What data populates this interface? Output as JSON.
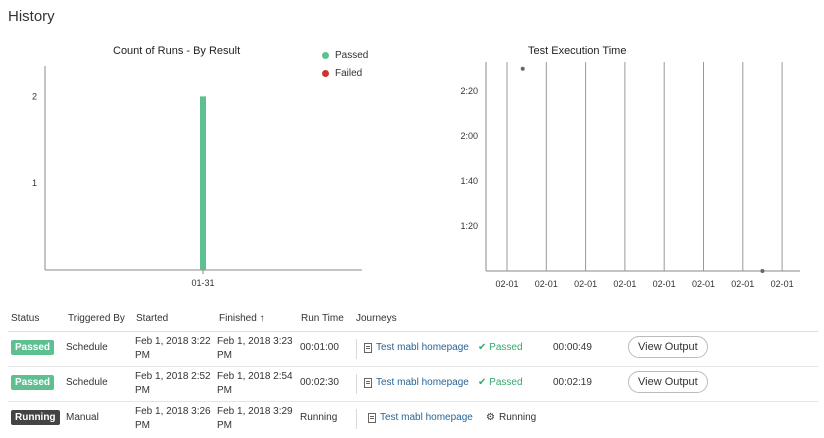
{
  "page": {
    "title": "History"
  },
  "colors": {
    "passed": "#5ec091",
    "failed": "#c8372d",
    "running": "#444444",
    "link": "#2a6496",
    "pass_text": "#35a86f"
  },
  "chart_data": [
    {
      "type": "bar",
      "title": "Count of Runs - By Result",
      "categories": [
        "01-31"
      ],
      "series": [
        {
          "name": "Passed",
          "values": [
            2
          ]
        },
        {
          "name": "Failed",
          "values": [
            0
          ]
        }
      ],
      "yticks": [
        "1",
        "2"
      ],
      "ylim": [
        0,
        2.35
      ],
      "legend_position": "top-right",
      "grid": false
    },
    {
      "type": "scatter",
      "title": "Test Execution Time",
      "xticks": [
        "02-01",
        "02-01",
        "02-01",
        "02-01",
        "02-01",
        "02-01",
        "02-01",
        "02-01"
      ],
      "yticks": [
        "1:20",
        "1:40",
        "2:00",
        "2:20"
      ],
      "ylim_seconds": [
        60,
        153
      ],
      "points": [
        {
          "x_index": 0.4,
          "y_seconds": 150
        },
        {
          "x_index": 6.5,
          "y_seconds": 60
        }
      ],
      "grid": true
    }
  ],
  "table": {
    "headers": {
      "status": "Status",
      "triggered_by": "Triggered By",
      "started": "Started",
      "finished": "Finished ↑",
      "run_time": "Run Time",
      "journeys": "Journeys"
    },
    "rows": [
      {
        "status": "Passed",
        "status_color": "#5ec091",
        "triggered_by": "Schedule",
        "started": "Feb 1, 2018 3:22 PM",
        "finished": "Feb 1, 2018 3:23 PM",
        "run_time": "00:01:00",
        "journey": "Test mabl homepage",
        "result": "Passed",
        "journey_time": "00:00:49",
        "action": "View Output"
      },
      {
        "status": "Passed",
        "status_color": "#5ec091",
        "triggered_by": "Schedule",
        "started": "Feb 1, 2018 2:52 PM",
        "finished": "Feb 1, 2018 2:54 PM",
        "run_time": "00:02:30",
        "journey": "Test mabl homepage",
        "result": "Passed",
        "journey_time": "00:02:19",
        "action": "View Output"
      },
      {
        "status": "Running",
        "status_color": "#444444",
        "triggered_by": "Manual",
        "started": "Feb 1, 2018 3:26 PM",
        "finished": "Feb 1, 2018 3:29 PM",
        "run_time": "Running",
        "journey": "Test mabl homepage",
        "result": "Running",
        "journey_time": "",
        "action": ""
      }
    ]
  }
}
